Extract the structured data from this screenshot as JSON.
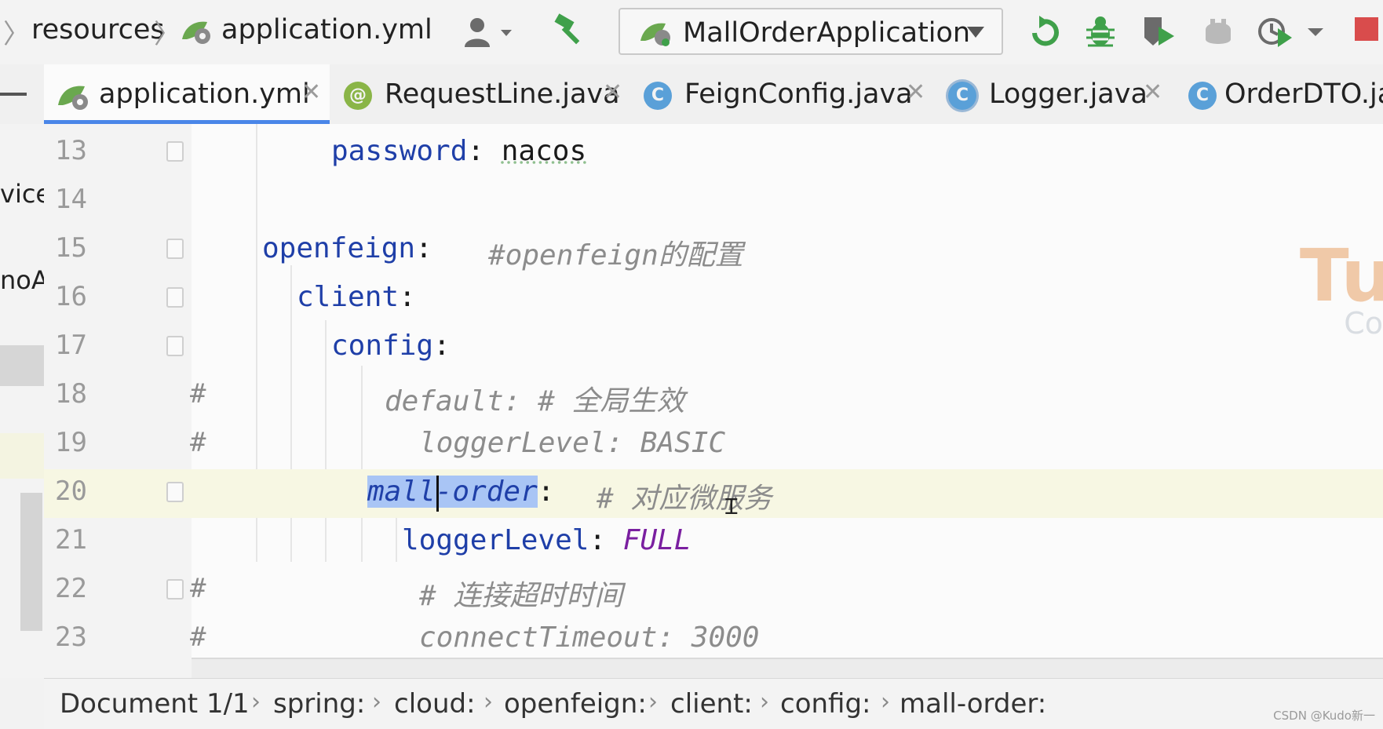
{
  "breadcrumb": {
    "items": [
      "resources",
      "application.yml"
    ]
  },
  "run_config": {
    "label": "MallOrderApplication"
  },
  "toolbar_icons": [
    "user-icon",
    "build-hammer-icon",
    "rerun-icon",
    "debug-icon",
    "run-coverage-icon",
    "profiler-icon",
    "run-history-icon",
    "stop-icon"
  ],
  "tabs": [
    {
      "label": "application.yml",
      "icon": "yml-icon",
      "active": true
    },
    {
      "label": "RequestLine.java",
      "icon": "annotation-icon",
      "icon_glyph": "@"
    },
    {
      "label": "FeignConfig.java",
      "icon": "class-icon",
      "icon_glyph": "C"
    },
    {
      "label": "Logger.java",
      "icon": "class-icon",
      "icon_glyph": "C"
    },
    {
      "label": "OrderDTO.jav",
      "icon": "class-icon",
      "icon_glyph": "C"
    }
  ],
  "left_fragments": [
    "vice",
    "noA"
  ],
  "editor": {
    "lines": [
      {
        "num": "13",
        "gutter": "",
        "key": "password",
        "sep": ": ",
        "value": "nacos",
        "comment": ""
      },
      {
        "num": "14",
        "gutter": "",
        "key": "",
        "sep": "",
        "value": "",
        "comment": ""
      },
      {
        "num": "15",
        "gutter": "",
        "key": "openfeign",
        "sep": ":",
        "value": "",
        "comment": "#openfeign的配置"
      },
      {
        "num": "16",
        "gutter": "",
        "key": "client",
        "sep": ":",
        "value": "",
        "comment": ""
      },
      {
        "num": "17",
        "gutter": "",
        "key": "config",
        "sep": ":",
        "value": "",
        "comment": ""
      },
      {
        "num": "18",
        "gutter": "#",
        "key": "",
        "sep": "",
        "value": "",
        "comment": "default: # 全局生效"
      },
      {
        "num": "19",
        "gutter": "#",
        "key": "",
        "sep": "",
        "value": "",
        "comment": "loggerLevel: BASIC"
      },
      {
        "num": "20",
        "gutter": "",
        "key_selected": "mall",
        "key_rest": "-order",
        "sep": ":",
        "value": "",
        "comment": "# 对应微服务"
      },
      {
        "num": "21",
        "gutter": "",
        "key": "loggerLevel",
        "sep": ": ",
        "value": "FULL",
        "comment": ""
      },
      {
        "num": "22",
        "gutter": "#",
        "key": "",
        "sep": "",
        "value": "",
        "comment": "# 连接超时时间"
      },
      {
        "num": "23",
        "gutter": "#",
        "key": "",
        "sep": "",
        "value": "",
        "comment": "connectTimeout: 3000"
      }
    ]
  },
  "status": {
    "document": "Document 1/1",
    "path": [
      "spring:",
      "cloud:",
      "openfeign:",
      "client:",
      "config:",
      "mall-order:"
    ]
  },
  "watermark": "CSDN @Kudo新一",
  "colors": {
    "tab_active_underline": "#4a86e8",
    "selection": "#a9c5f5",
    "yaml_key": "#1f3fa8",
    "enum_value": "#7a1fa0",
    "comment": "#8c8c8c",
    "run_green": "#3fa04a",
    "stop_red": "#d94c4c"
  }
}
